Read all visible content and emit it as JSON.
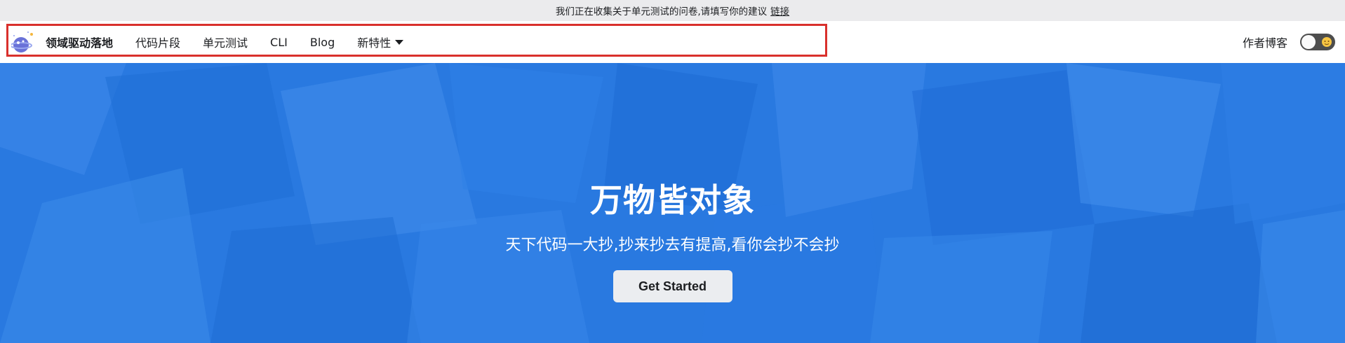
{
  "announcement": {
    "text": "我们正在收集关于单元测试的问卷,请填写你的建议",
    "link_label": "链接"
  },
  "navbar": {
    "brand_title": "领域驱动落地",
    "links": [
      "代码片段",
      "单元测试",
      "CLI",
      "Blog"
    ],
    "dropdown_label": "新特性",
    "right_link": "作者博客"
  },
  "hero": {
    "title": "万物皆对象",
    "subtitle": "天下代码一大抄,抄来抄去有提高,看你会抄不会抄",
    "button_label": "Get Started"
  },
  "colors": {
    "hero_bg": "#2979e0",
    "highlight_border": "#d9302c",
    "announcement_bg": "#ebebed"
  },
  "icons": {
    "logo": "planet-logo-icon",
    "theme_toggle": "sun-icon"
  }
}
